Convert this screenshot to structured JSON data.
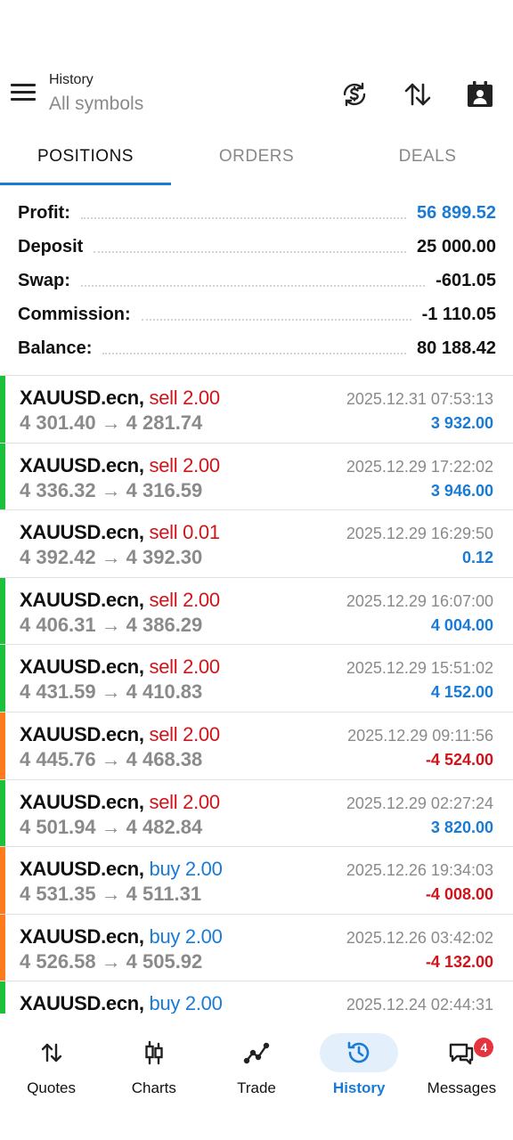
{
  "header": {
    "title": "History",
    "subtitle": "All symbols"
  },
  "tabs": [
    {
      "label": "POSITIONS",
      "active": true
    },
    {
      "label": "ORDERS",
      "active": false
    },
    {
      "label": "DEALS",
      "active": false
    }
  ],
  "summary": {
    "profit": {
      "label": "Profit:",
      "value": "56 899.52"
    },
    "deposit": {
      "label": "Deposit",
      "value": "25 000.00"
    },
    "swap": {
      "label": "Swap:",
      "value": "-601.05"
    },
    "commission": {
      "label": "Commission:",
      "value": "-1 110.05"
    },
    "balance": {
      "label": "Balance:",
      "value": "80 188.42"
    }
  },
  "positions": [
    {
      "symbol": "XAUUSD.ecn,",
      "side": "sell",
      "lots": "sell 2.00",
      "open": "4 301.40",
      "close": "4 281.74",
      "time": "2025.12.31 07:53:13",
      "profit": "3 932.00",
      "bar": "green"
    },
    {
      "symbol": "XAUUSD.ecn,",
      "side": "sell",
      "lots": "sell 2.00",
      "open": "4 336.32",
      "close": "4 316.59",
      "time": "2025.12.29 17:22:02",
      "profit": "3 946.00",
      "bar": "green"
    },
    {
      "symbol": "XAUUSD.ecn,",
      "side": "sell",
      "lots": "sell 0.01",
      "open": "4 392.42",
      "close": "4 392.30",
      "time": "2025.12.29 16:29:50",
      "profit": "0.12",
      "bar": "none"
    },
    {
      "symbol": "XAUUSD.ecn,",
      "side": "sell",
      "lots": "sell 2.00",
      "open": "4 406.31",
      "close": "4 386.29",
      "time": "2025.12.29 16:07:00",
      "profit": "4 004.00",
      "bar": "green"
    },
    {
      "symbol": "XAUUSD.ecn,",
      "side": "sell",
      "lots": "sell 2.00",
      "open": "4 431.59",
      "close": "4 410.83",
      "time": "2025.12.29 15:51:02",
      "profit": "4 152.00",
      "bar": "green"
    },
    {
      "symbol": "XAUUSD.ecn,",
      "side": "sell",
      "lots": "sell 2.00",
      "open": "4 445.76",
      "close": "4 468.38",
      "time": "2025.12.29 09:11:56",
      "profit": "-4 524.00",
      "bar": "orange"
    },
    {
      "symbol": "XAUUSD.ecn,",
      "side": "sell",
      "lots": "sell 2.00",
      "open": "4 501.94",
      "close": "4 482.84",
      "time": "2025.12.29 02:27:24",
      "profit": "3 820.00",
      "bar": "green"
    },
    {
      "symbol": "XAUUSD.ecn,",
      "side": "buy",
      "lots": "buy 2.00",
      "open": "4 531.35",
      "close": "4 511.31",
      "time": "2025.12.26 19:34:03",
      "profit": "-4 008.00",
      "bar": "orange"
    },
    {
      "symbol": "XAUUSD.ecn,",
      "side": "buy",
      "lots": "buy 2.00",
      "open": "4 526.58",
      "close": "4 505.92",
      "time": "2025.12.26 03:42:02",
      "profit": "-4 132.00",
      "bar": "orange"
    },
    {
      "symbol": "XAUUSD.ecn,",
      "side": "buy",
      "lots": "buy 2.00",
      "open": "",
      "close": "",
      "time": "2025.12.24 02:44:31",
      "profit": "",
      "bar": "green"
    }
  ],
  "arrow_glyph": "→",
  "nav": [
    {
      "label": "Quotes",
      "icon": "quotes-icon",
      "active": false
    },
    {
      "label": "Charts",
      "icon": "charts-icon",
      "active": false
    },
    {
      "label": "Trade",
      "icon": "trade-icon",
      "active": false
    },
    {
      "label": "History",
      "icon": "history-icon",
      "active": true
    },
    {
      "label": "Messages",
      "icon": "messages-icon",
      "active": false,
      "badge": "4"
    }
  ],
  "colors": {
    "accent": "#1a7bd6",
    "sell": "#d0141a",
    "loss": "#d0141a",
    "profit_bar": "#1cc03a",
    "loss_bar": "#ff7a1a",
    "badge": "#e5343d"
  }
}
